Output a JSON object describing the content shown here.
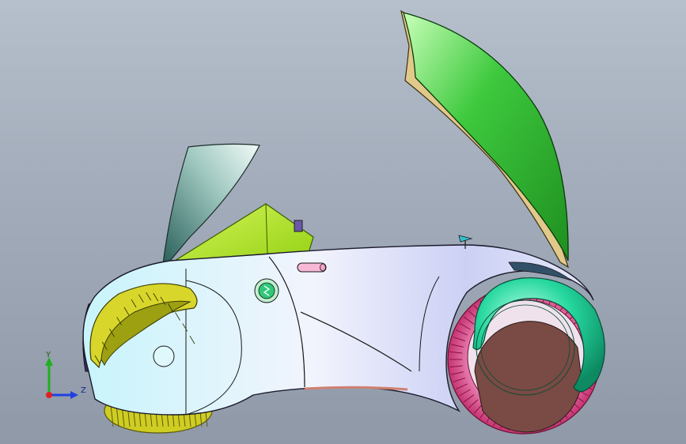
{
  "viewport": {
    "background_top": "#b6c0cc",
    "background_bottom": "#8f99a8"
  },
  "model": {
    "body_color": "#dfe4fb",
    "canopy_color": "#2faa2f",
    "nose_fin_color": "#aee61c",
    "tyre_color": "#cc2a6a",
    "front_tyre_color": "#d8d62a",
    "rear_hub_color": "#21d49b",
    "wheel_center_color": "#7a4a45"
  },
  "triad": {
    "y_label": "Y",
    "z_label": "Z",
    "x_color": "#e02020",
    "y_color": "#20b020",
    "z_color": "#2040e0"
  }
}
